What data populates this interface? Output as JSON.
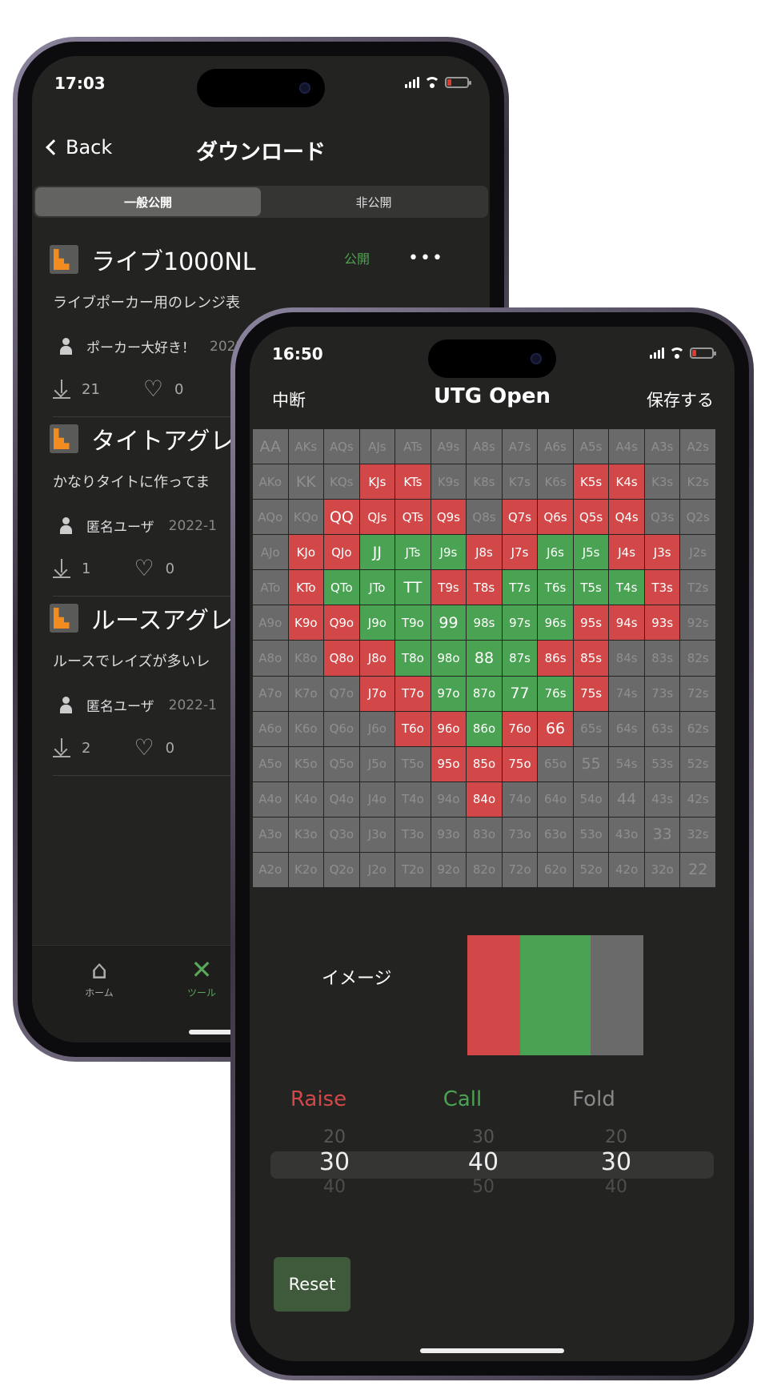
{
  "phone_back": {
    "status_time": "17:03",
    "back_label": "Back",
    "title": "ダウンロード",
    "segments": [
      "一般公開",
      "非公開"
    ],
    "items": [
      {
        "name": "ライブ1000NL",
        "badge": "公開",
        "desc": "ライブポーカー用のレンジ表",
        "user": "ポーカー大好き！",
        "date": "2022-11",
        "downloads": "21",
        "likes": "0"
      },
      {
        "name": "タイトアグレ",
        "badge": "",
        "desc": "かなりタイトに作ってま",
        "user": "匿名ユーザ",
        "date": "2022-1",
        "downloads": "1",
        "likes": "0"
      },
      {
        "name": "ルースアグレ",
        "badge": "",
        "desc": "ルースでレイズが多いレ",
        "user": "匿名ユーザ",
        "date": "2022-1",
        "downloads": "2",
        "likes": "0"
      }
    ],
    "tabs": [
      {
        "label": "ホーム",
        "icon": "home-icon"
      },
      {
        "label": "ツール",
        "icon": "tools-icon"
      }
    ]
  },
  "phone_front": {
    "status_time": "16:50",
    "left_button": "中断",
    "title": "UTG Open",
    "right_button": "保存する",
    "colors": {
      "raise": "#d24848",
      "call": "#4aa352",
      "fold": "#6a6a6a"
    },
    "hand_rows": [
      [
        "AA",
        "AKs",
        "AQs",
        "AJs",
        "ATs",
        "A9s",
        "A8s",
        "A7s",
        "A6s",
        "A5s",
        "A4s",
        "A3s",
        "A2s"
      ],
      [
        "AKo",
        "KK",
        "KQs",
        "KJs",
        "KTs",
        "K9s",
        "K8s",
        "K7s",
        "K6s",
        "K5s",
        "K4s",
        "K3s",
        "K2s"
      ],
      [
        "AQo",
        "KQo",
        "QQ",
        "QJs",
        "QTs",
        "Q9s",
        "Q8s",
        "Q7s",
        "Q6s",
        "Q5s",
        "Q4s",
        "Q3s",
        "Q2s"
      ],
      [
        "AJo",
        "KJo",
        "QJo",
        "JJ",
        "JTs",
        "J9s",
        "J8s",
        "J7s",
        "J6s",
        "J5s",
        "J4s",
        "J3s",
        "J2s"
      ],
      [
        "ATo",
        "KTo",
        "QTo",
        "JTo",
        "TT",
        "T9s",
        "T8s",
        "T7s",
        "T6s",
        "T5s",
        "T4s",
        "T3s",
        "T2s"
      ],
      [
        "A9o",
        "K9o",
        "Q9o",
        "J9o",
        "T9o",
        "99",
        "98s",
        "97s",
        "96s",
        "95s",
        "94s",
        "93s",
        "92s"
      ],
      [
        "A8o",
        "K8o",
        "Q8o",
        "J8o",
        "T8o",
        "98o",
        "88",
        "87s",
        "86s",
        "85s",
        "84s",
        "83s",
        "82s"
      ],
      [
        "A7o",
        "K7o",
        "Q7o",
        "J7o",
        "T7o",
        "97o",
        "87o",
        "77",
        "76s",
        "75s",
        "74s",
        "73s",
        "72s"
      ],
      [
        "A6o",
        "K6o",
        "Q6o",
        "J6o",
        "T6o",
        "96o",
        "86o",
        "76o",
        "66",
        "65s",
        "64s",
        "63s",
        "62s"
      ],
      [
        "A5o",
        "K5o",
        "Q5o",
        "J5o",
        "T5o",
        "95o",
        "85o",
        "75o",
        "65o",
        "55",
        "54s",
        "53s",
        "52s"
      ],
      [
        "A4o",
        "K4o",
        "Q4o",
        "J4o",
        "T4o",
        "94o",
        "84o",
        "74o",
        "64o",
        "54o",
        "44",
        "43s",
        "42s"
      ],
      [
        "A3o",
        "K3o",
        "Q3o",
        "J3o",
        "T3o",
        "93o",
        "83o",
        "73o",
        "63o",
        "53o",
        "43o",
        "33",
        "32s"
      ],
      [
        "A2o",
        "K2o",
        "Q2o",
        "J2o",
        "T2o",
        "92o",
        "82o",
        "72o",
        "62o",
        "52o",
        "42o",
        "32o",
        "22"
      ]
    ],
    "action_rows": [
      "fffffffffffff",
      "fffrrffffrrff",
      "ffrrrrfrrrrff",
      "frrcccrrccrrf",
      "frcccrrccccrf",
      "frrccccccrrrf",
      "ffrrccccrrfff",
      "fffrrccccrfff",
      "ffffrrcrrffff",
      "fffffrrrfffff",
      "ffffffrffffff",
      "fffffffffffff",
      "fffffffffffff"
    ],
    "image_label": "イメージ",
    "mix": {
      "raise": 30,
      "call": 40,
      "fold": 30
    },
    "actions": [
      "Raise",
      "Call",
      "Fold"
    ],
    "pickers": [
      {
        "prev": "20",
        "value": "30",
        "next": "40"
      },
      {
        "prev": "30",
        "value": "40",
        "next": "50"
      },
      {
        "prev": "20",
        "value": "30",
        "next": "40"
      }
    ],
    "reset_label": "Reset"
  }
}
